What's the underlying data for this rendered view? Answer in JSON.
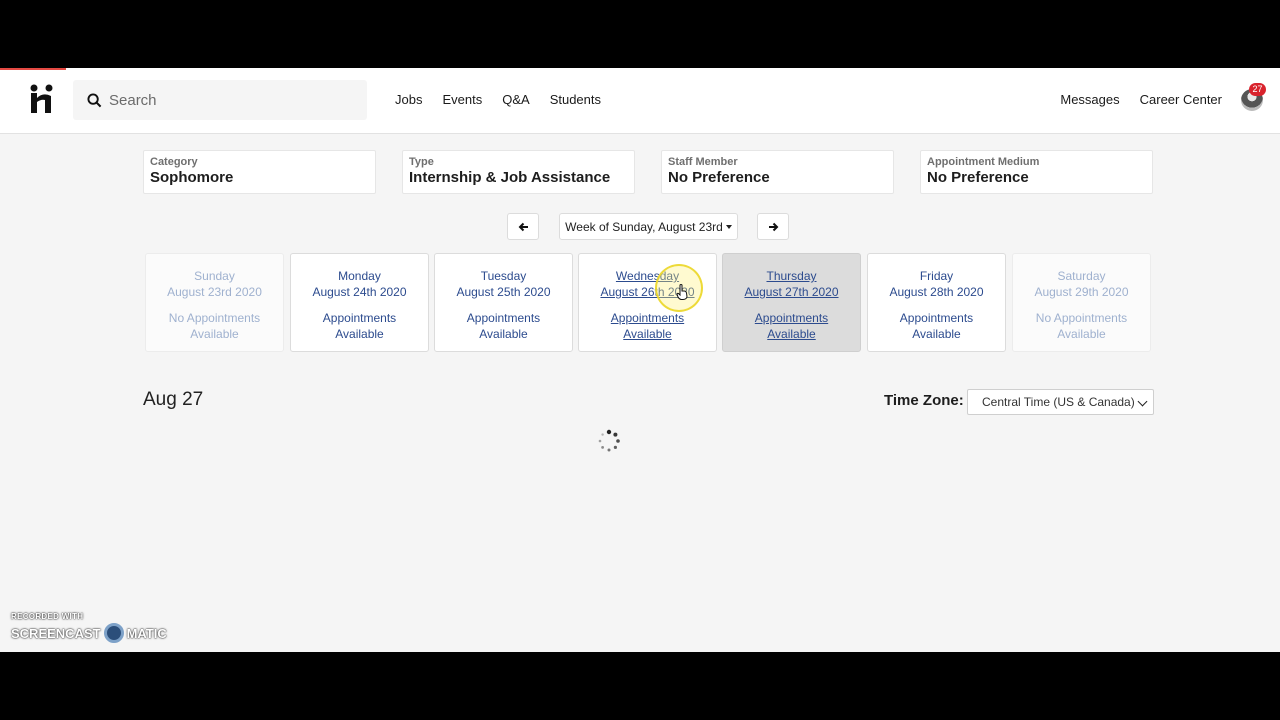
{
  "header": {
    "search_placeholder": "Search",
    "nav_left": [
      "Jobs",
      "Events",
      "Q&A",
      "Students"
    ],
    "nav_right": [
      "Messages",
      "Career Center"
    ],
    "notification_count": "27"
  },
  "filters": [
    {
      "label": "Category",
      "value": "Sophomore"
    },
    {
      "label": "Type",
      "value": "Internship & Job Assistance"
    },
    {
      "label": "Staff Member",
      "value": "No Preference"
    },
    {
      "label": "Appointment Medium",
      "value": "No Preference"
    }
  ],
  "week_selector": {
    "label": "Week of Sunday, August 23rd"
  },
  "days": [
    {
      "weekday": "Sunday",
      "date": "August 23rd 2020",
      "avail_1": "No Appointments",
      "avail_2": "Available"
    },
    {
      "weekday": "Monday",
      "date": "August 24th 2020",
      "avail_1": "Appointments",
      "avail_2": "Available"
    },
    {
      "weekday": "Tuesday",
      "date": "August 25th 2020",
      "avail_1": "Appointments",
      "avail_2": "Available"
    },
    {
      "weekday": "Wednesday",
      "date": "August 26th 2020",
      "avail_1": "Appointments",
      "avail_2": "Available"
    },
    {
      "weekday": "Thursday",
      "date": "August 27th 2020",
      "avail_1": "Appointments",
      "avail_2": "Available"
    },
    {
      "weekday": "Friday",
      "date": "August 28th 2020",
      "avail_1": "Appointments",
      "avail_2": "Available"
    },
    {
      "weekday": "Saturday",
      "date": "August 29th 2020",
      "avail_1": "No Appointments",
      "avail_2": "Available"
    }
  ],
  "selected_date_heading": "Aug 27",
  "timezone": {
    "label": "Time Zone:",
    "selected": "Central Time (US & Canada)"
  },
  "watermark": {
    "line1": "RECORDED WITH",
    "line2a": "SCREENCAST",
    "line2b": "MATIC"
  },
  "colors": {
    "link_blue": "#2c4b8e",
    "disabled_blue": "#9fb1cf",
    "badge_red": "#d9232d",
    "selected_day_bg": "#dcdcdc"
  }
}
